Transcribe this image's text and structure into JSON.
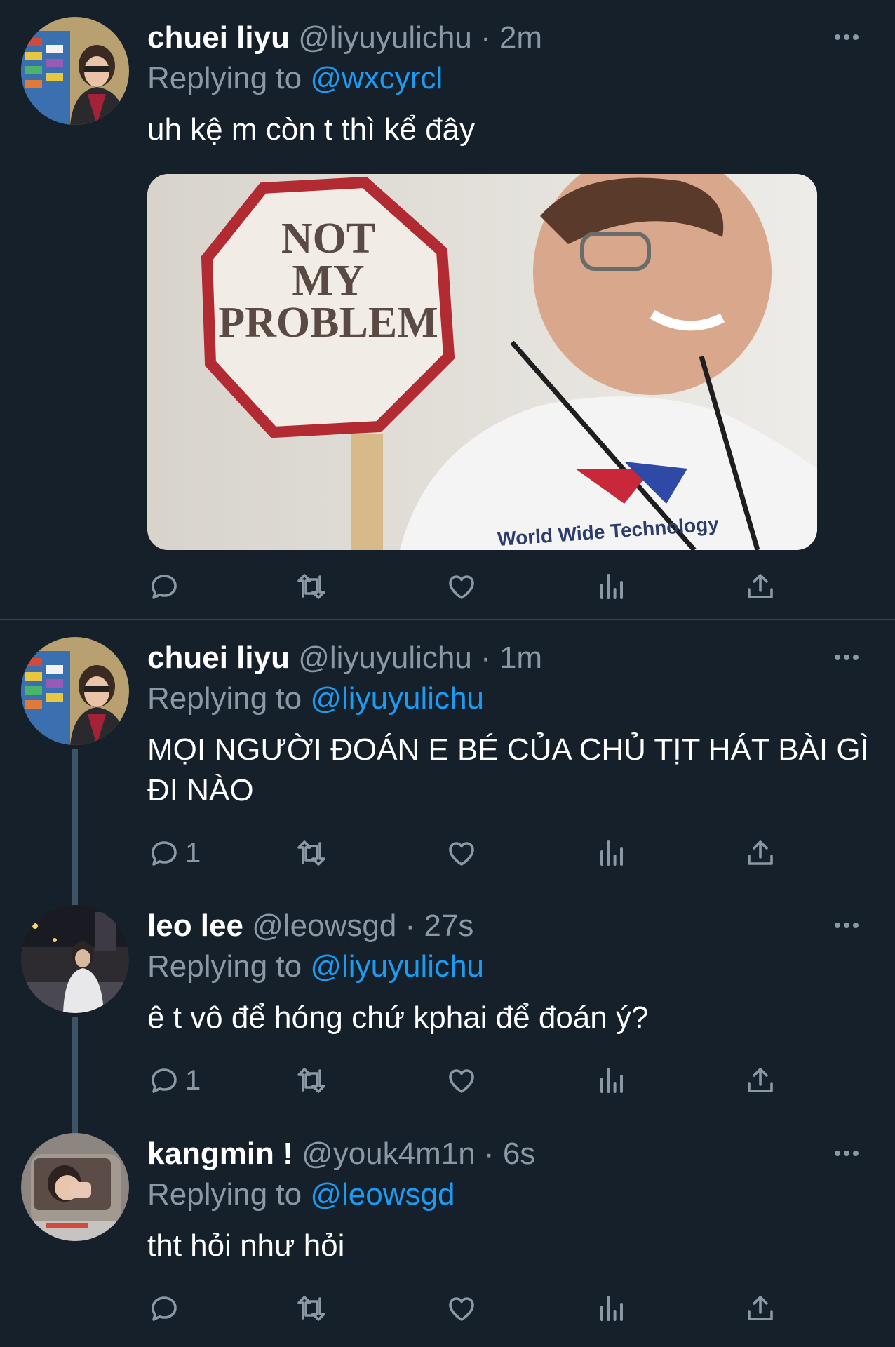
{
  "tweets": [
    {
      "name": "chuei liyu",
      "handle": "@liyuyulichu",
      "time": "2m",
      "replying_prefix": "Replying to ",
      "replying_to": "@wxcyrcl",
      "text": "uh kệ m còn t thì kể đây",
      "media": {
        "sign_line1": "NOT",
        "sign_line2": "MY",
        "sign_line3": "PROBLEM",
        "shirt_text": "World Wide Technology"
      },
      "reply_count": "",
      "avatar_icon": "avatar-photo"
    },
    {
      "name": "chuei liyu",
      "handle": "@liyuyulichu",
      "time": "1m",
      "replying_prefix": "Replying to ",
      "replying_to": "@liyuyulichu",
      "text": "MỌI NGƯỜI ĐOÁN E BÉ CỦA CHỦ TỊT HÁT BÀI GÌ ĐI NÀO",
      "reply_count": "1"
    },
    {
      "name": "leo lee",
      "handle": "@leowsgd",
      "time": "27s",
      "replying_prefix": "Replying to ",
      "replying_to": "@liyuyulichu",
      "text": "ê t vô để hóng chứ kphai để đoán ý?",
      "reply_count": "1"
    },
    {
      "name": "kangmin !",
      "handle": "@youk4m1n",
      "time": "6s",
      "replying_prefix": "Replying to ",
      "replying_to": "@leowsgd",
      "text": "tht hỏi như hỏi",
      "reply_count": ""
    }
  ],
  "separator": " · ",
  "colors": {
    "background": "#15202b",
    "accent": "#1d9bf0",
    "muted": "#8b98a5",
    "divider": "#38444d"
  },
  "icons": [
    "reply-icon",
    "retweet-icon",
    "like-icon",
    "analytics-icon",
    "share-icon",
    "more-icon"
  ]
}
